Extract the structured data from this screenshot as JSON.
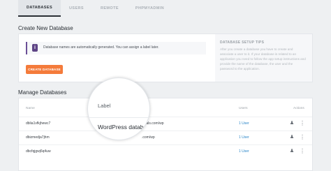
{
  "tabs": [
    {
      "label": "DATABASES",
      "active": true
    },
    {
      "label": "USERS",
      "active": false
    },
    {
      "label": "REMOTE",
      "active": false
    },
    {
      "label": "PHPMYADMIN",
      "active": false
    }
  ],
  "create_section": {
    "title": "Create New Database",
    "info_text": "Database names are automatically generated. You can assign a label later.",
    "button_label": "CREATE DATABASE",
    "tips_title": "DATABASE SETUP TIPS",
    "tips_body": "After you create a database you have to create and associate a user to it. If your database is related to an application you need to follow the app setup instructions and provide the name of the database, the user and the password to the application."
  },
  "manage_section": {
    "title": "Manage Databases",
    "columns": {
      "name": "Name",
      "users": "Users",
      "actions": "Actions"
    },
    "rows": [
      {
        "name": "dblia1vfkjhewc7",
        "label": "",
        "users": "1 User",
        "wp": "sitegroundtutorials.com/wp"
      },
      {
        "name": "dbizmedja7jhm",
        "label": "",
        "users": "1 User",
        "wp": ".com/wp"
      },
      {
        "name": "dbcfqjgwj6q4uw",
        "label": "",
        "users": "1 User",
        "wp": ""
      }
    ]
  },
  "magnifier": {
    "label_header": "Label",
    "value": "WordPress databa"
  },
  "icons": {
    "info": "info-icon",
    "assign_user": "user-plus-icon",
    "more": "more-vertical-icon"
  },
  "colors": {
    "accent_orange": "#f47b3b",
    "info_purple": "#5e4485",
    "link_blue": "#2a86c8"
  }
}
